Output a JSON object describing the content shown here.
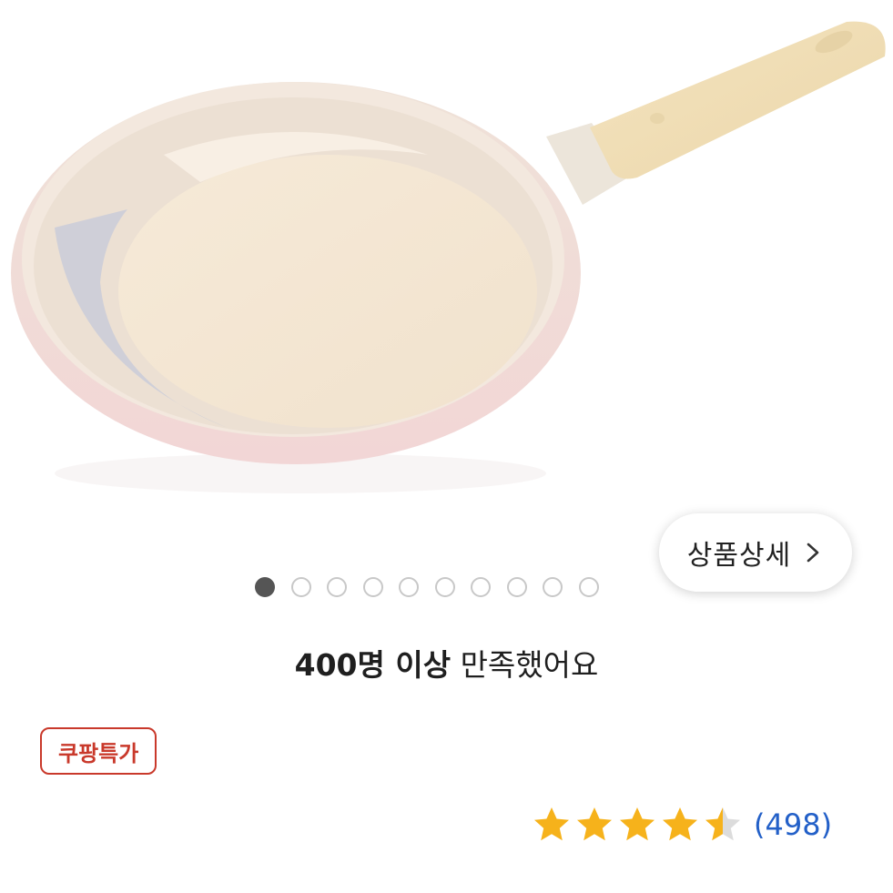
{
  "product": {
    "image_alt": "product-frying-pan-image"
  },
  "detail_button": {
    "label": "상품상세",
    "icon": "chevron-right-icon"
  },
  "carousel": {
    "total": 10,
    "active_index": 0
  },
  "satisfaction": {
    "count_text": "400명 이상",
    "suffix_text": " 만족했어요"
  },
  "badge": {
    "label": "쿠팡특가",
    "color": "#c9392b"
  },
  "rating": {
    "value": 4.5,
    "max": 5,
    "review_count_text": "(498)",
    "star_color": "#f6b21b",
    "count_color": "#2360c8"
  }
}
